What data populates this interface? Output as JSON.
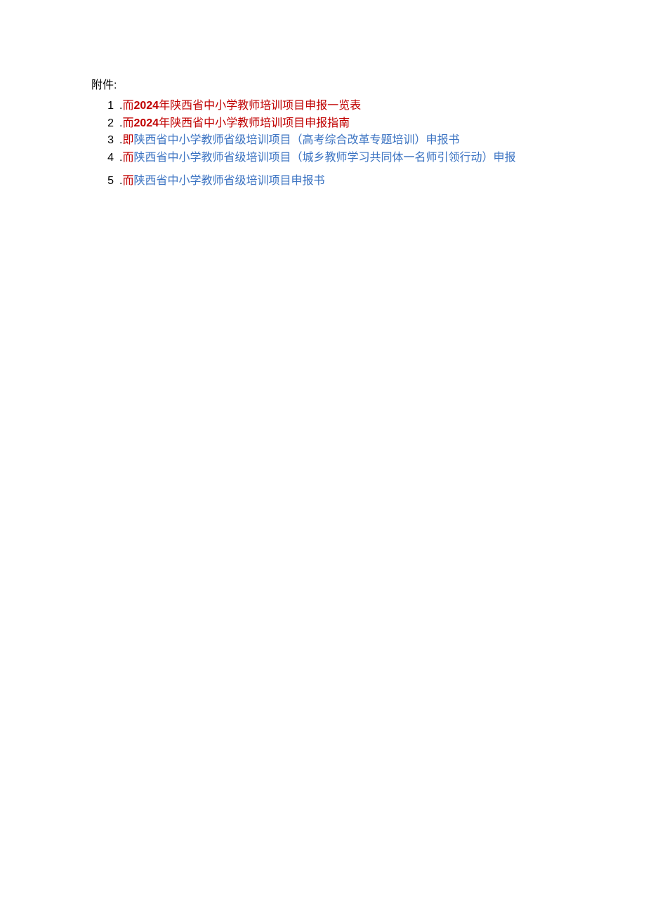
{
  "header_label": "附件:",
  "items": [
    {
      "num": "1",
      "dot": ".",
      "prefix": "而",
      "year": "2024",
      "rest": "年陕西省中小学教师培训项目申报一览表",
      "style": "red-bold"
    },
    {
      "num": "2",
      "dot": ".",
      "prefix": "而",
      "year": "2024",
      "rest": "年陕西省中小学教师培训项目申报指南",
      "style": "red-bold"
    },
    {
      "num": "3",
      "dot": ".",
      "prefix": "即",
      "rest": "陕西省中小学教师省级培训项目（高考综合改革专题培训）申报书",
      "style": "blue"
    },
    {
      "num": "4",
      "dot": ".",
      "prefix": "而",
      "rest": "陕西省中小学教师省级培训项目（城乡教师学习共同体一名师引领行动）申报",
      "style": "blue"
    },
    {
      "num": "5",
      "dot": ".",
      "prefix": "而",
      "rest": "陕西省中小学教师省级培训项目申报书",
      "style": "blue"
    }
  ]
}
